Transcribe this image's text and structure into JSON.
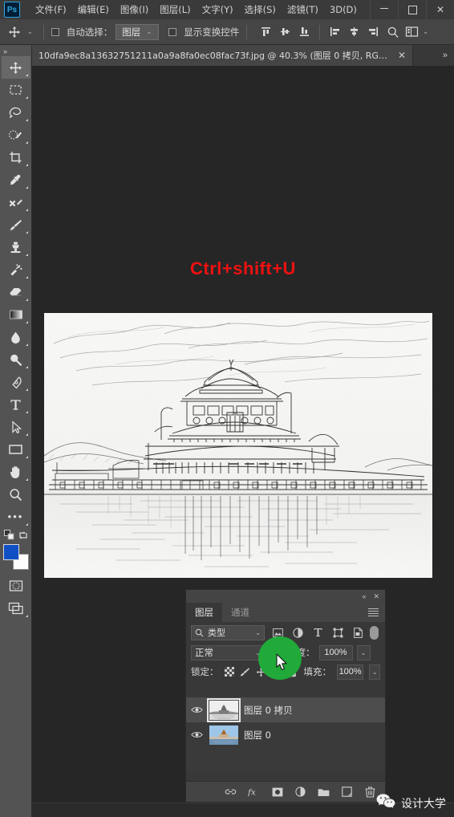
{
  "app": {
    "logo_text": "Ps",
    "menus": [
      {
        "label": "文件(F)",
        "name": "menu-file"
      },
      {
        "label": "编辑(E)",
        "name": "menu-edit"
      },
      {
        "label": "图像(I)",
        "name": "menu-image"
      },
      {
        "label": "图层(L)",
        "name": "menu-layer"
      },
      {
        "label": "文字(Y)",
        "name": "menu-type"
      },
      {
        "label": "选择(S)",
        "name": "menu-select"
      },
      {
        "label": "滤镜(T)",
        "name": "menu-filter"
      },
      {
        "label": "3D(D)",
        "name": "menu-3d"
      }
    ],
    "window_controls": {
      "minimize": "",
      "maximize": "",
      "close": "✕"
    }
  },
  "options_bar": {
    "tool_icon": "move-tool-icon",
    "auto_select_label": "自动选择：",
    "auto_select_checked": false,
    "auto_select_value": "图层",
    "show_transform_label": "显示变换控件",
    "show_transform_checked": false,
    "align_icons": [
      "align-top-edges-icon",
      "align-vertical-centers-icon",
      "align-bottom-edges-icon",
      "align-left-edges-icon",
      "align-horizontal-centers-icon",
      "align-right-edges-icon"
    ],
    "search_icon": "search-icon",
    "workspace_icon": "workspace-icon"
  },
  "toolbar": {
    "expand_label": "»",
    "tools": [
      {
        "name": "move-tool",
        "icon": "move-icon",
        "active": true
      },
      {
        "name": "marquee-tool",
        "icon": "rectangular-marquee-icon",
        "active": false
      },
      {
        "name": "lasso-tool",
        "icon": "lasso-icon",
        "active": false
      },
      {
        "name": "quick-selection-tool",
        "icon": "quick-selection-icon",
        "active": false
      },
      {
        "name": "crop-tool",
        "icon": "crop-icon",
        "active": false
      },
      {
        "name": "eyedropper-tool",
        "icon": "eyedropper-icon",
        "active": false
      },
      {
        "name": "healing-brush-tool",
        "icon": "spot-healing-icon",
        "active": false
      },
      {
        "name": "brush-tool",
        "icon": "brush-icon",
        "active": false
      },
      {
        "name": "clone-stamp-tool",
        "icon": "clone-stamp-icon",
        "active": false
      },
      {
        "name": "history-brush-tool",
        "icon": "history-brush-icon",
        "active": false
      },
      {
        "name": "eraser-tool",
        "icon": "eraser-icon",
        "active": false
      },
      {
        "name": "gradient-tool",
        "icon": "gradient-icon",
        "active": false
      },
      {
        "name": "blur-tool",
        "icon": "blur-drop-icon",
        "active": false
      },
      {
        "name": "dodge-tool",
        "icon": "dodge-icon",
        "active": false
      },
      {
        "name": "pen-tool",
        "icon": "pen-icon",
        "active": false
      },
      {
        "name": "type-tool",
        "icon": "type-T-icon",
        "active": false
      },
      {
        "name": "path-selection-tool",
        "icon": "path-selection-arrow-icon",
        "active": false
      },
      {
        "name": "rectangle-tool",
        "icon": "rectangle-shape-icon",
        "active": false
      },
      {
        "name": "hand-tool",
        "icon": "hand-icon",
        "active": false
      },
      {
        "name": "zoom-tool",
        "icon": "zoom-magnifier-icon",
        "active": false
      },
      {
        "name": "edit-toolbar",
        "icon": "ellipsis-icon",
        "active": false
      }
    ],
    "colors": {
      "foreground": "#1150c4",
      "background": "#fdfdfd"
    },
    "quick_mask_icon": "quick-mask-icon",
    "screen_mode_icon": "screen-mode-icon",
    "default_colors_icon": "default-colors-icon",
    "swap_colors_icon": "swap-colors-icon"
  },
  "document_tab": {
    "title": "10dfa9ec8a13632751211a0a9a8fa0ec08fac73f.jpg @ 40.3% (图层 0 拷贝, RGB/8#...",
    "close_glyph": "✕",
    "overflow_glyph": "»"
  },
  "canvas": {
    "hint_text": "Ctrl+shift+U",
    "hint_color": "#ee1111",
    "background_color": "#262626",
    "artwork_description": "pencil-sketch-of-chinese-palace-by-lake"
  },
  "layers_panel": {
    "collapse_glyph": "«",
    "close_glyph": "✕",
    "tabs": [
      {
        "label": "图层",
        "name": "tab-layers",
        "active": true
      },
      {
        "label": "通道",
        "name": "tab-channels",
        "active": false
      }
    ],
    "menu_icon": "panel-menu-icon",
    "filter": {
      "search_icon": "search-icon",
      "value": "类型",
      "caret": "⌄",
      "type_icons": [
        "filter-pixel-layers-icon",
        "filter-adjustment-layers-icon",
        "filter-type-layers-icon",
        "filter-shape-layers-icon",
        "filter-smart-object-icon"
      ],
      "toggle_name": "filter-enable-toggle"
    },
    "blend_mode": "正常",
    "blend_caret": "⌄",
    "opacity_label": "不透明度：",
    "opacity_value": "100%",
    "lock_label": "锁定：",
    "lock_icons": [
      "lock-transparent-pixels-icon",
      "lock-image-pixels-icon",
      "lock-position-icon",
      "lock-artboard-nesting-icon",
      "lock-all-icon"
    ],
    "fill_label": "填充：",
    "fill_value": "100%",
    "layers": [
      {
        "name": "图层 0 拷贝",
        "visible": true,
        "selected": true,
        "thumb": "grayscale"
      },
      {
        "name": "图层 0",
        "visible": true,
        "selected": false,
        "thumb": "color"
      }
    ],
    "bottom_icons": [
      "link-layers-icon",
      "layer-style-fx-icon",
      "add-layer-mask-icon",
      "new-adjustment-layer-icon",
      "new-group-icon",
      "new-layer-icon",
      "delete-layer-icon"
    ]
  },
  "overlay": {
    "highlight_color": "#21a93a",
    "cursor_icon": "mouse-pointer-icon"
  },
  "watermark": {
    "icon": "wechat-icon",
    "text": "设计大学"
  }
}
